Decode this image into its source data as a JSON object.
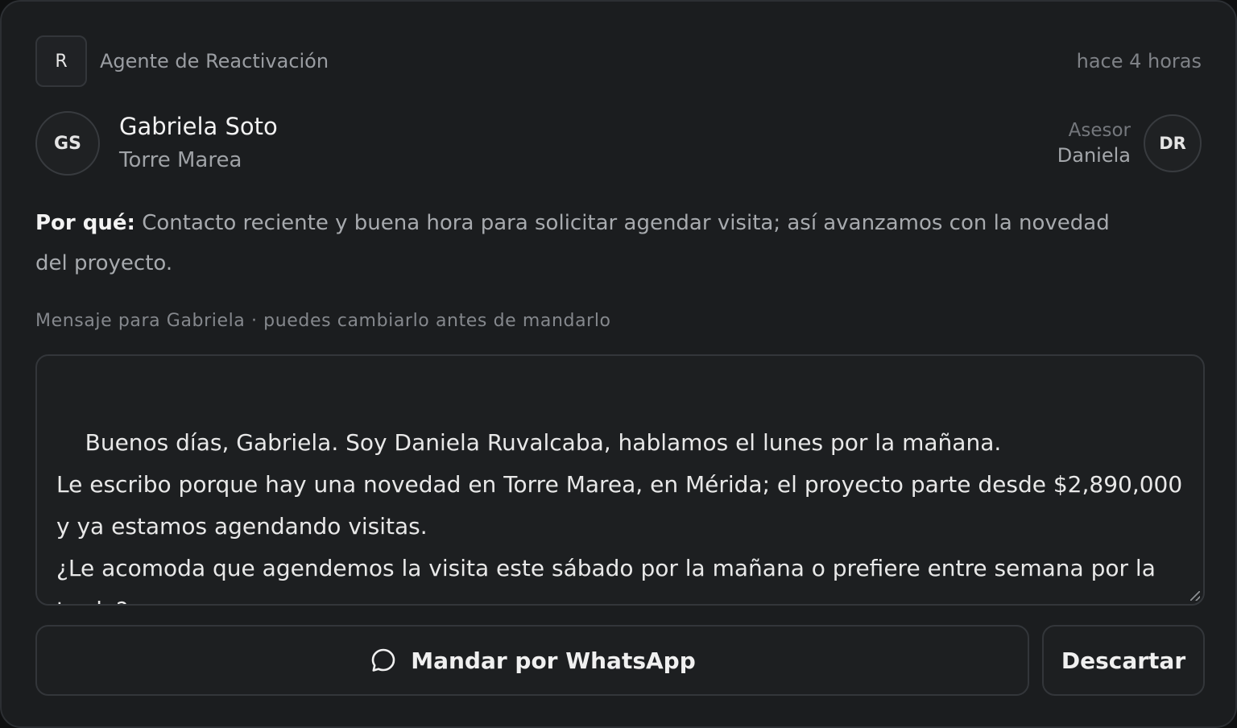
{
  "agent": {
    "badge": "R",
    "name": "Agente de Reactivación",
    "time": "hace 4 horas"
  },
  "contact": {
    "initials": "GS",
    "name": "Gabriela Soto",
    "project": "Torre Marea"
  },
  "advisor": {
    "label": "Asesor",
    "name": "Daniela",
    "initials": "DR"
  },
  "reason": {
    "label": "Por qué:",
    "text": "Contacto reciente y buena hora para solicitar agendar visita; así avanzamos con la novedad del proyecto."
  },
  "message": {
    "caption": "Mensaje para Gabriela · puedes cambiarlo antes de mandarlo",
    "text": "Buenos días, Gabriela. Soy Daniela Ruvalcaba, hablamos el lunes por la mañana.\nLe escribo porque hay una novedad en Torre Marea, en Mérida; el proyecto parte desde $2,890,000 y ya estamos agendando visitas.\n¿Le acomoda que agendemos la visita este sábado por la mañana o prefiere entre semana por la tarde?"
  },
  "actions": {
    "send_label": "Mandar por WhatsApp",
    "send_icon": "chat-bubble-icon",
    "discard_label": "Descartar"
  }
}
